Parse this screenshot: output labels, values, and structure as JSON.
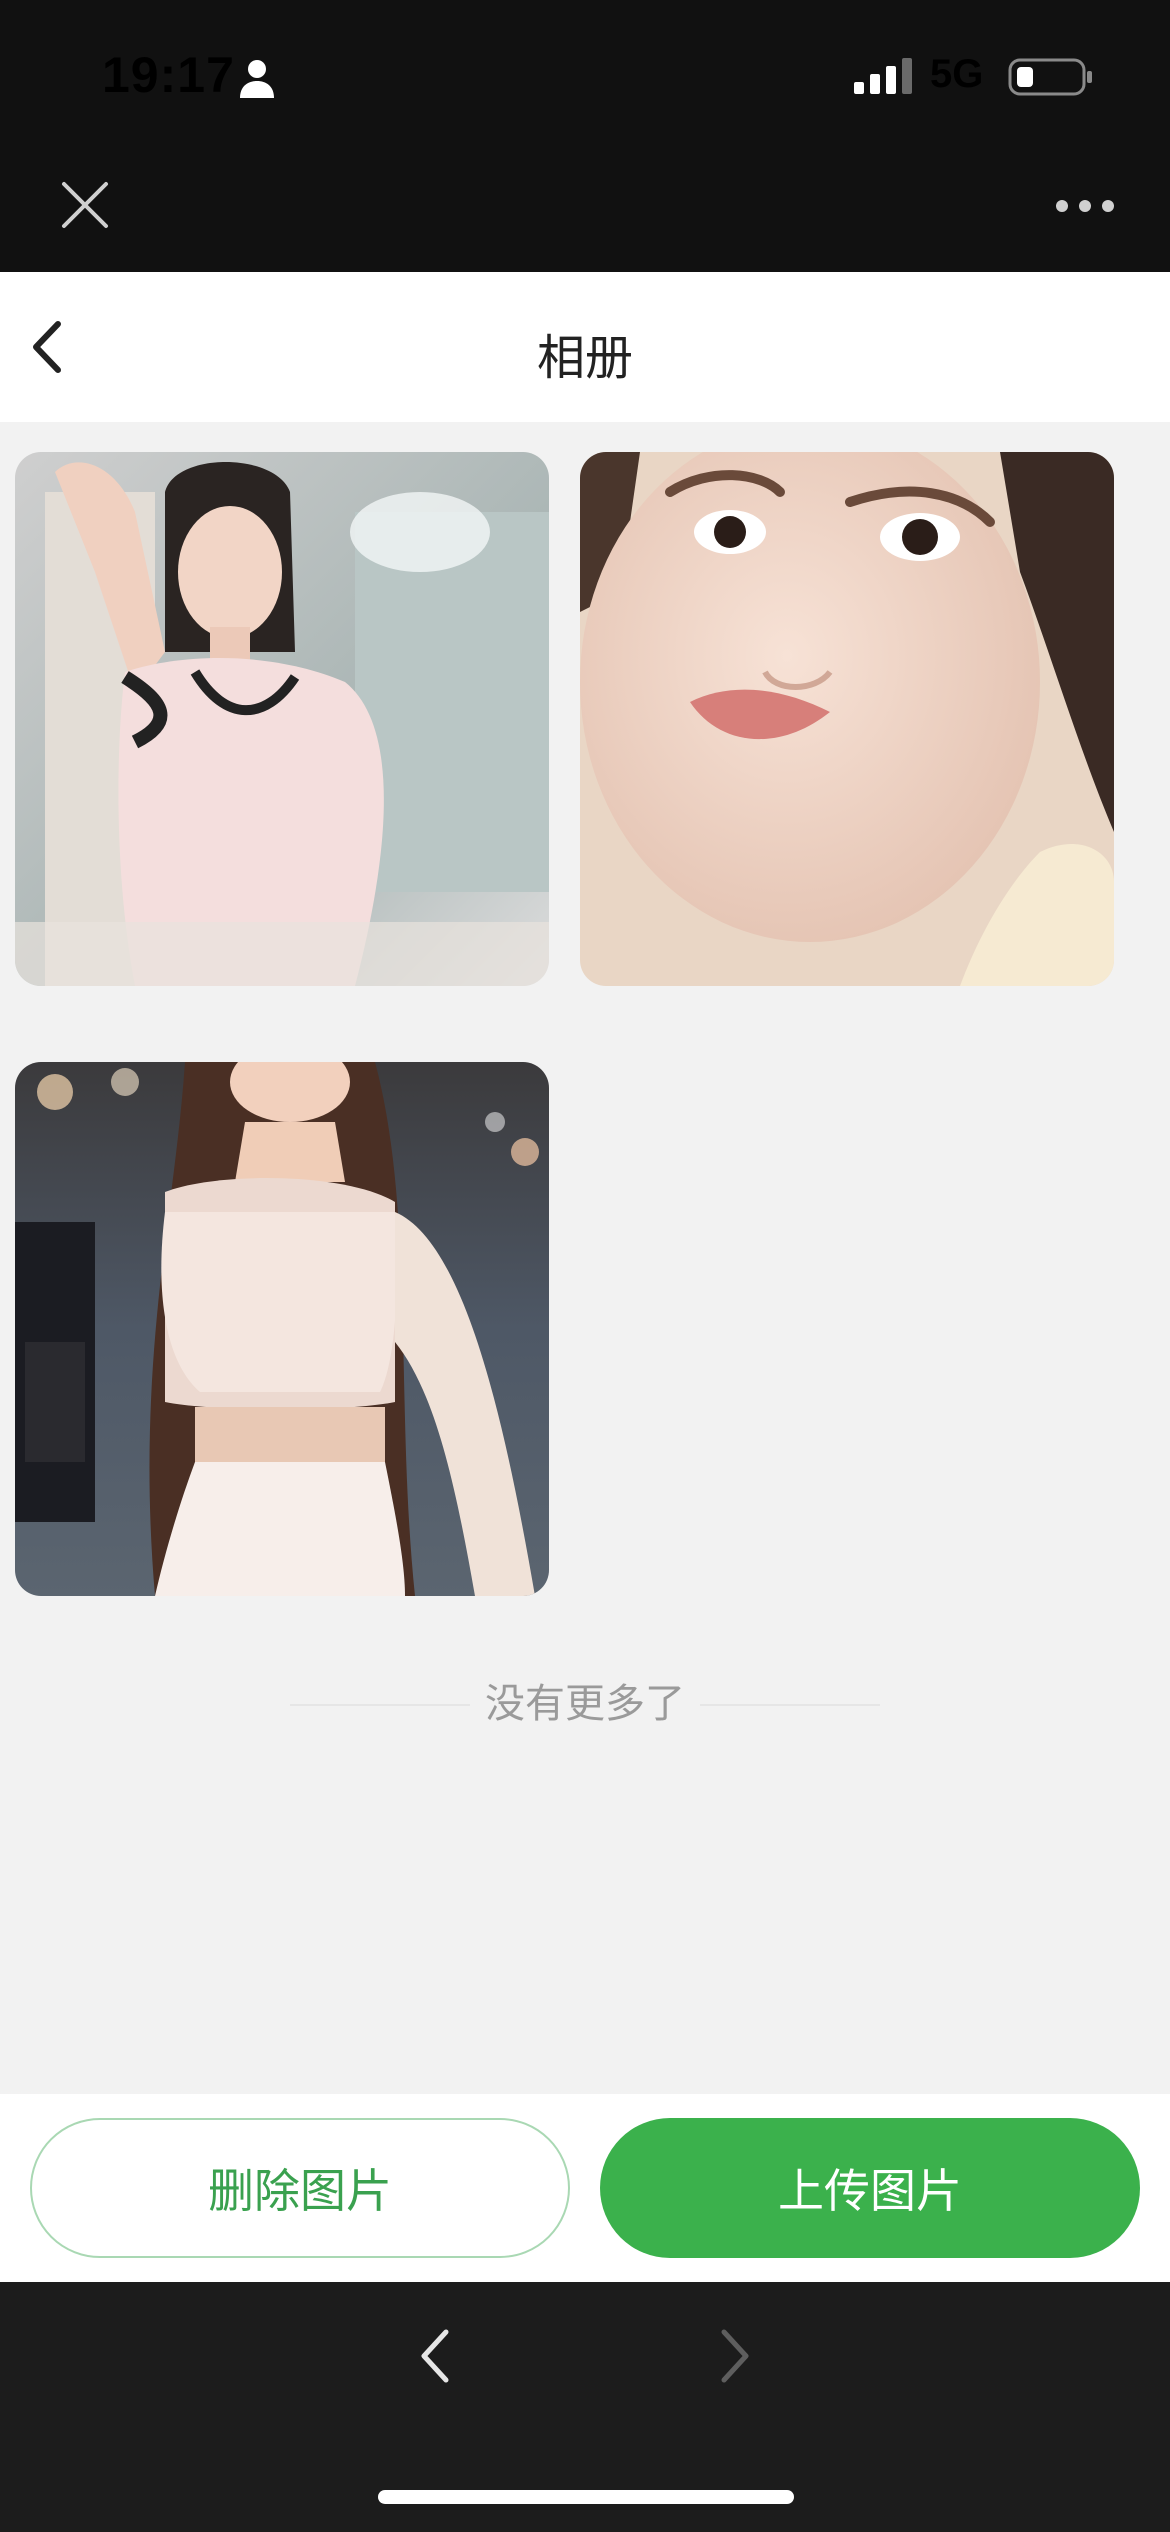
{
  "status_bar": {
    "time": "19:17",
    "network": "5G",
    "icons": [
      "person-icon",
      "signal-icon",
      "battery-icon"
    ]
  },
  "webview": {
    "icons": [
      "close-icon",
      "more-icon"
    ]
  },
  "header": {
    "title": "相册",
    "back_icon": "chevron-left-icon"
  },
  "album": {
    "photos": [
      {
        "id": "photo-1"
      },
      {
        "id": "photo-2"
      },
      {
        "id": "photo-3"
      }
    ],
    "end_text": "没有更多了"
  },
  "actions": {
    "delete_label": "删除图片",
    "upload_label": "上传图片"
  },
  "colors": {
    "accent": "#3bb14c",
    "background": "#f2f2f2",
    "top_bar": "#111111",
    "bottom_bar": "#1c1c1c"
  }
}
